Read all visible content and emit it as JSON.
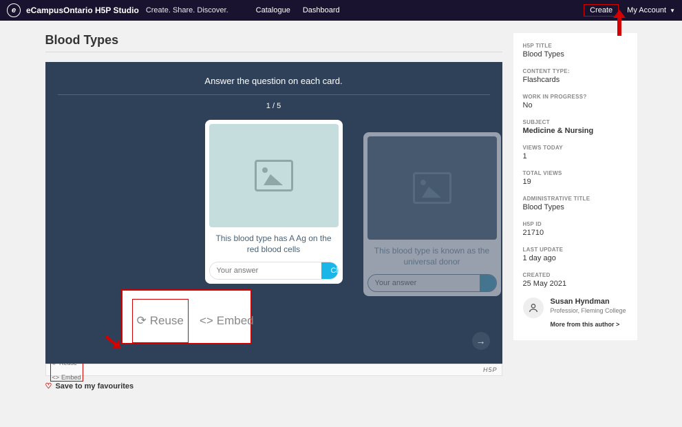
{
  "nav": {
    "brand": "eCampusOntario H5P Studio",
    "tagline": "Create. Share. Discover.",
    "links": {
      "catalogue": "Catalogue",
      "dashboard": "Dashboard"
    },
    "create": "Create",
    "account": "My Account"
  },
  "page": {
    "title": "Blood Types"
  },
  "h5p": {
    "instruction": "Answer the question on each card.",
    "progress": "1 / 5",
    "card1": {
      "question": "This blood type has A Ag on the red blood cells",
      "placeholder": "Your answer",
      "check": "Check"
    },
    "card2": {
      "question": "This blood type is known as the universal donor",
      "placeholder": "Your answer"
    },
    "footer": {
      "reuse": "Reuse",
      "embed": "Embed",
      "brand": "H5P"
    }
  },
  "callout": {
    "reuse": "Reuse",
    "embed": "Embed"
  },
  "favourite": "Save to my favourites",
  "meta": {
    "h5p_title_label": "H5P TITLE",
    "h5p_title": "Blood Types",
    "content_type_label": "CONTENT TYPE:",
    "content_type": "Flashcards",
    "wip_label": "WORK IN PROGRESS?",
    "wip": "No",
    "subject_label": "SUBJECT",
    "subject": "Medicine & Nursing",
    "views_today_label": "VIEWS TODAY",
    "views_today": "1",
    "total_views_label": "TOTAL VIEWS",
    "total_views": "19",
    "admin_title_label": "ADMINISTRATIVE TITLE",
    "admin_title": "Blood Types",
    "h5p_id_label": "H5P ID",
    "h5p_id": "21710",
    "last_update_label": "LAST UPDATE",
    "last_update": "1 day ago",
    "created_label": "CREATED",
    "created": "25 May 2021"
  },
  "author": {
    "name": "Susan Hyndman",
    "role": "Professior, Fleming College",
    "more": "More from this author >"
  }
}
